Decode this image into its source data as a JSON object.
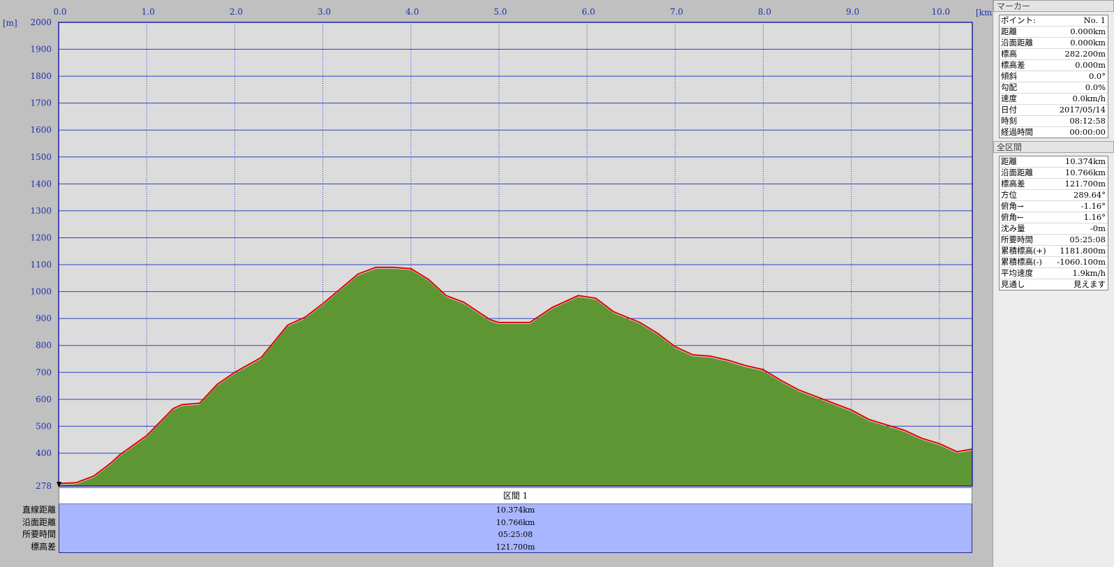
{
  "chart_data": {
    "type": "area",
    "x_unit": "[km]",
    "y_unit": "[m]",
    "xlim": [
      0.0,
      10.374
    ],
    "ylim": [
      278,
      2000
    ],
    "x_ticks": [
      "0.0",
      "1.0",
      "2.0",
      "3.0",
      "4.0",
      "5.0",
      "6.0",
      "7.0",
      "8.0",
      "9.0",
      "10.0"
    ],
    "y_ticks": [
      "2000",
      "1900",
      "1800",
      "1700",
      "1600",
      "1500",
      "1400",
      "1300",
      "1200",
      "1100",
      "1000",
      "900",
      "800",
      "700",
      "600",
      "500",
      "400",
      "278"
    ],
    "grid": true,
    "colors": {
      "fill": "#5f9634",
      "line": "#e00000",
      "grid": "#3040c0",
      "plot_bg": "#dcdcdc"
    },
    "x": [
      0.0,
      0.2,
      0.4,
      0.6,
      0.7,
      1.0,
      1.3,
      1.4,
      1.6,
      1.8,
      2.0,
      2.3,
      2.4,
      2.6,
      2.8,
      3.0,
      3.2,
      3.4,
      3.6,
      3.8,
      4.0,
      4.2,
      4.4,
      4.6,
      4.9,
      5.0,
      5.35,
      5.6,
      5.9,
      6.1,
      6.3,
      6.6,
      6.8,
      7.0,
      7.2,
      7.4,
      7.6,
      7.8,
      8.0,
      8.2,
      8.4,
      8.8,
      9.0,
      9.2,
      9.4,
      9.6,
      9.8,
      10.0,
      10.2,
      10.374
    ],
    "elevation": [
      282,
      285,
      310,
      360,
      390,
      460,
      560,
      575,
      580,
      650,
      695,
      750,
      790,
      870,
      900,
      950,
      1005,
      1060,
      1085,
      1085,
      1080,
      1040,
      980,
      955,
      890,
      880,
      880,
      935,
      980,
      970,
      920,
      880,
      840,
      790,
      760,
      755,
      740,
      720,
      705,
      665,
      630,
      580,
      555,
      520,
      500,
      480,
      450,
      430,
      400,
      410
    ]
  },
  "section": {
    "header": "区間 1",
    "labels": [
      "直線距離",
      "沿面距離",
      "所要時間",
      "標高差"
    ],
    "values": [
      "10.374km",
      "10.766km",
      "05:25:08",
      "121.700m"
    ]
  },
  "marker_panel": {
    "title": "マーカー",
    "rows": [
      {
        "key": "ポイント:",
        "val": "No. 1"
      },
      {
        "key": "距離",
        "val": "0.000km"
      },
      {
        "key": "沿面距離",
        "val": "0.000km"
      },
      {
        "key": "標高",
        "val": "282.200m"
      },
      {
        "key": "標高差",
        "val": "0.000m"
      },
      {
        "key": "傾斜",
        "val": "0.0°"
      },
      {
        "key": "勾配",
        "val": "0.0%"
      },
      {
        "key": "速度",
        "val": "0.0km/h"
      },
      {
        "key": "日付",
        "val": "2017/05/14"
      },
      {
        "key": "時刻",
        "val": "08:12:58"
      },
      {
        "key": "経過時間",
        "val": "00:00:00"
      }
    ]
  },
  "total_panel": {
    "title": "全区間",
    "rows": [
      {
        "key": "距離",
        "val": "10.374km"
      },
      {
        "key": "沿面距離",
        "val": "10.766km"
      },
      {
        "key": "標高差",
        "val": "121.700m"
      },
      {
        "key": "方位",
        "val": "289.64°"
      },
      {
        "key": "俯角→",
        "val": "-1.16°"
      },
      {
        "key": "俯角←",
        "val": "1.16°"
      },
      {
        "key": "沈み量",
        "val": "-0m"
      },
      {
        "key": "所要時間",
        "val": "05:25:08"
      },
      {
        "key": "累積標高(+)",
        "val": "1181.800m"
      },
      {
        "key": "累積標高(-)",
        "val": "-1060.100m"
      },
      {
        "key": "平均速度",
        "val": "1.9km/h"
      },
      {
        "key": "見通し",
        "val": "見えます"
      }
    ]
  }
}
